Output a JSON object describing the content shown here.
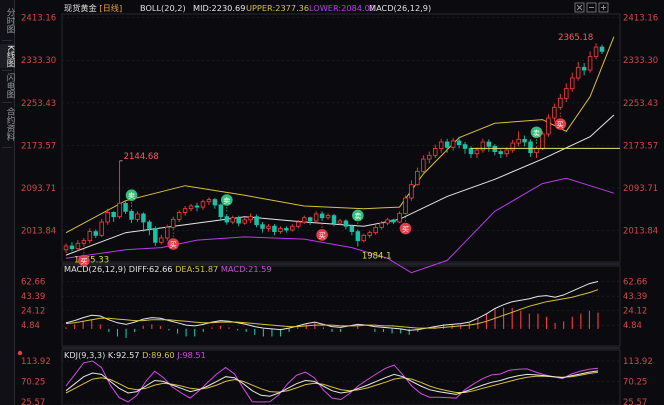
{
  "sidebar": {
    "tabs": [
      {
        "label": "分时图",
        "active": false
      },
      {
        "label": "K线图",
        "active": true
      },
      {
        "label": "闪电图",
        "active": false
      },
      {
        "label": "合约资料",
        "active": false
      }
    ]
  },
  "main_info": {
    "symbol": "现货黄金",
    "period": "[日线]",
    "boll": "BOLL(20,2)",
    "mid": "MID:2230.69",
    "upper": "UPPER:2377.36",
    "lower": "LOWER:2084.02",
    "macd": "MACD(26,12,9)"
  },
  "macd_info": {
    "name": "MACD(26,12,9)",
    "diff": "DIFF:62.66",
    "dea": "DEA:51.87",
    "macd": "MACD:21.59"
  },
  "kdj_info": {
    "name": "KDJ(9,3,3)",
    "k": "K:92.57",
    "d": "D:89.60",
    "j": "J:98.51"
  },
  "colors": {
    "up": "#ff3b3b",
    "down": "#19c2a6",
    "mid": "#e7e7e7",
    "upper": "#d7c03e",
    "lower": "#b93be6",
    "bg": "#0b0b0f",
    "grid": "#2a2a33"
  },
  "chart_data": [
    {
      "type": "candlestick",
      "title": "现货黄金 [日线]",
      "y_ticks": [
        2413.16,
        2333.3,
        2253.43,
        2173.57,
        2093.71,
        2013.84
      ],
      "ylim": [
        1955,
        2420
      ],
      "annotations": [
        {
          "text": "2144.68",
          "kind": "high"
        },
        {
          "text": "1965.33",
          "kind": "low"
        },
        {
          "text": "1984.1",
          "kind": "low"
        },
        {
          "text": "2365.18",
          "kind": "high"
        }
      ],
      "signals": [
        "卖",
        "买"
      ],
      "candles": [
        [
          1978,
          1985,
          1972,
          1990
        ],
        [
          1985,
          1980,
          1975,
          1992
        ],
        [
          1980,
          1990,
          1976,
          1996
        ],
        [
          1990,
          1995,
          1984,
          2000
        ],
        [
          1995,
          2012,
          1990,
          2018
        ],
        [
          2012,
          2005,
          2000,
          2016
        ],
        [
          2005,
          2030,
          2002,
          2036
        ],
        [
          2030,
          2048,
          2025,
          2055
        ],
        [
          2048,
          2040,
          2030,
          2050
        ],
        [
          2040,
          2065,
          2036,
          2144.68
        ],
        [
          2065,
          2050,
          2045,
          2070
        ],
        [
          2050,
          2035,
          2028,
          2054
        ],
        [
          2035,
          2045,
          2030,
          2050
        ],
        [
          2045,
          2030,
          2012,
          2048
        ],
        [
          2030,
          2018,
          2005,
          2034
        ],
        [
          2018,
          1992,
          1985,
          2022
        ],
        [
          1992,
          2000,
          1988,
          2006
        ],
        [
          2000,
          2020,
          1995,
          2025
        ],
        [
          2020,
          2035,
          2015,
          2040
        ],
        [
          2035,
          2048,
          2030,
          2052
        ],
        [
          2048,
          2055,
          2042,
          2060
        ],
        [
          2055,
          2060,
          2050,
          2064
        ],
        [
          2060,
          2058,
          2050,
          2066
        ],
        [
          2058,
          2068,
          2053,
          2072
        ],
        [
          2068,
          2072,
          2062,
          2076
        ],
        [
          2072,
          2062,
          2055,
          2075
        ],
        [
          2062,
          2040,
          2035,
          2065
        ],
        [
          2040,
          2030,
          2025,
          2045
        ],
        [
          2030,
          2038,
          2026,
          2042
        ],
        [
          2038,
          2028,
          2022,
          2042
        ],
        [
          2028,
          2034,
          2025,
          2038
        ],
        [
          2034,
          2040,
          2028,
          2046
        ],
        [
          2040,
          2025,
          2020,
          2044
        ],
        [
          2025,
          2018,
          2010,
          2030
        ],
        [
          2018,
          2022,
          2012,
          2026
        ],
        [
          2022,
          2012,
          2005,
          2026
        ],
        [
          2012,
          2018,
          2008,
          2022
        ],
        [
          2018,
          2015,
          2010,
          2022
        ],
        [
          2015,
          2022,
          2012,
          2026
        ],
        [
          2022,
          2030,
          2018,
          2034
        ],
        [
          2030,
          2038,
          2026,
          2042
        ],
        [
          2038,
          2032,
          2025,
          2040
        ],
        [
          2032,
          2045,
          2028,
          2050
        ],
        [
          2045,
          2038,
          2032,
          2050
        ],
        [
          2038,
          2042,
          2034,
          2046
        ],
        [
          2042,
          2028,
          2022,
          2045
        ],
        [
          2028,
          2032,
          2024,
          2036
        ],
        [
          2032,
          2022,
          2016,
          2035
        ],
        [
          2022,
          2012,
          2005,
          2025
        ],
        [
          2012,
          1995,
          1984.1,
          2016
        ],
        [
          1995,
          2005,
          1992,
          2008
        ],
        [
          2005,
          2010,
          2000,
          2014
        ],
        [
          2010,
          2020,
          2006,
          2024
        ],
        [
          2020,
          2028,
          2016,
          2032
        ],
        [
          2028,
          2034,
          2024,
          2038
        ],
        [
          2034,
          2030,
          2026,
          2036
        ],
        [
          2030,
          2046,
          2028,
          2050
        ],
        [
          2046,
          2075,
          2044,
          2080
        ],
        [
          2075,
          2100,
          2070,
          2108
        ],
        [
          2100,
          2125,
          2098,
          2132
        ],
        [
          2125,
          2148,
          2120,
          2155
        ],
        [
          2148,
          2155,
          2140,
          2162
        ],
        [
          2155,
          2168,
          2150,
          2175
        ],
        [
          2168,
          2180,
          2160,
          2186
        ],
        [
          2180,
          2170,
          2160,
          2186
        ],
        [
          2170,
          2182,
          2164,
          2188
        ],
        [
          2182,
          2175,
          2168,
          2190
        ],
        [
          2175,
          2168,
          2158,
          2180
        ],
        [
          2168,
          2158,
          2150,
          2172
        ],
        [
          2158,
          2165,
          2150,
          2170
        ],
        [
          2165,
          2180,
          2160,
          2186
        ],
        [
          2180,
          2172,
          2162,
          2185
        ],
        [
          2172,
          2162,
          2155,
          2176
        ],
        [
          2162,
          2158,
          2150,
          2166
        ],
        [
          2158,
          2165,
          2152,
          2170
        ],
        [
          2165,
          2178,
          2160,
          2184
        ],
        [
          2178,
          2185,
          2172,
          2200
        ],
        [
          2185,
          2180,
          2172,
          2192
        ],
        [
          2180,
          2160,
          2152,
          2185
        ],
        [
          2160,
          2168,
          2150,
          2172
        ],
        [
          2168,
          2195,
          2165,
          2200
        ],
        [
          2195,
          2225,
          2190,
          2232
        ],
        [
          2225,
          2245,
          2218,
          2252
        ],
        [
          2245,
          2262,
          2240,
          2270
        ],
        [
          2262,
          2280,
          2255,
          2290
        ],
        [
          2280,
          2300,
          2274,
          2310
        ],
        [
          2300,
          2320,
          2295,
          2330
        ],
        [
          2320,
          2315,
          2305,
          2328
        ],
        [
          2315,
          2340,
          2310,
          2350
        ],
        [
          2340,
          2358,
          2335,
          2365.18
        ],
        [
          2358,
          2350,
          2345,
          2362
        ]
      ],
      "boll": {
        "mid": [
          [
            0,
            1968
          ],
          [
            10,
            2010
          ],
          [
            20,
            2025
          ],
          [
            30,
            2040
          ],
          [
            40,
            2030
          ],
          [
            50,
            2022
          ],
          [
            56,
            2035
          ],
          [
            64,
            2078
          ],
          [
            72,
            2110
          ],
          [
            80,
            2148
          ],
          [
            88,
            2190
          ],
          [
            92,
            2230.69
          ]
        ],
        "upper": [
          [
            0,
            2010
          ],
          [
            10,
            2070
          ],
          [
            20,
            2098
          ],
          [
            30,
            2080
          ],
          [
            40,
            2060
          ],
          [
            50,
            2055
          ],
          [
            56,
            2058
          ],
          [
            60,
            2120
          ],
          [
            66,
            2188
          ],
          [
            72,
            2215
          ],
          [
            80,
            2222
          ],
          [
            84,
            2200
          ],
          [
            88,
            2265
          ],
          [
            92,
            2377.36
          ]
        ],
        "lower": [
          [
            0,
            1962
          ],
          [
            10,
            1978
          ],
          [
            16,
            1982
          ],
          [
            22,
            1996
          ],
          [
            30,
            2002
          ],
          [
            40,
            1998
          ],
          [
            48,
            1982
          ],
          [
            54,
            1962
          ],
          [
            58,
            1935
          ],
          [
            64,
            1958
          ],
          [
            72,
            2050
          ],
          [
            80,
            2102
          ],
          [
            84,
            2112
          ],
          [
            88,
            2098
          ],
          [
            92,
            2084.02
          ]
        ]
      },
      "markers": [
        {
          "i": 3,
          "type": "买",
          "side": "below"
        },
        {
          "i": 11,
          "type": "卖",
          "side": "above"
        },
        {
          "i": 18,
          "type": "买",
          "side": "below"
        },
        {
          "i": 27,
          "type": "卖",
          "side": "above"
        },
        {
          "i": 43,
          "type": "买",
          "side": "below"
        },
        {
          "i": 49,
          "type": "卖",
          "side": "above"
        },
        {
          "i": 57,
          "type": "买",
          "side": "below"
        },
        {
          "i": 79,
          "type": "卖",
          "side": "above"
        },
        {
          "i": 83,
          "type": "买",
          "side": "below"
        }
      ],
      "hline": 2168
    },
    {
      "type": "macd",
      "title": "MACD(26,12,9)",
      "y_ticks": [
        62.66,
        43.39,
        24.12,
        4.84
      ],
      "ylim": [
        -20,
        70
      ],
      "diff": [
        8,
        11,
        15,
        18,
        17,
        12,
        8,
        6,
        9,
        13,
        15,
        14,
        11,
        8,
        5,
        4,
        6,
        9,
        11,
        10,
        8,
        6,
        3,
        1,
        0,
        -1,
        1,
        4,
        7,
        9,
        6,
        3,
        2,
        4,
        6,
        5,
        3,
        2,
        1,
        0,
        -2,
        -1,
        1,
        3,
        5,
        6,
        7,
        9,
        14,
        20,
        27,
        32,
        36,
        38,
        40,
        43,
        44,
        42,
        45,
        50,
        55,
        60,
        62.66
      ],
      "dea": [
        7,
        8,
        10,
        12,
        14,
        14,
        13,
        12,
        11,
        11,
        12,
        12,
        12,
        11,
        10,
        9,
        8,
        8,
        9,
        9,
        9,
        8,
        7,
        6,
        5,
        4,
        3,
        3,
        4,
        5,
        5,
        5,
        4,
        4,
        4,
        5,
        5,
        4,
        4,
        3,
        2,
        1,
        1,
        1,
        2,
        3,
        4,
        5,
        7,
        10,
        14,
        18,
        22,
        26,
        30,
        33,
        36,
        38,
        40,
        42,
        45,
        48,
        51.87
      ]
    },
    {
      "type": "kdj",
      "title": "KDJ(9,3,3)",
      "y_ticks": [
        113.92,
        70.25,
        25.57
      ],
      "ylim": [
        25.57,
        125
      ],
      "k": [
        50,
        65,
        80,
        88,
        85,
        70,
        55,
        45,
        48,
        60,
        72,
        70,
        62,
        55,
        48,
        52,
        60,
        70,
        80,
        78,
        65,
        50,
        40,
        38,
        45,
        55,
        65,
        72,
        70,
        60,
        50,
        45,
        48,
        55,
        62,
        70,
        78,
        85,
        80,
        70,
        60,
        52,
        48,
        45,
        42,
        48,
        55,
        62,
        68,
        72,
        78,
        82,
        85,
        84,
        82,
        80,
        78,
        82,
        86,
        90,
        92.57
      ],
      "d": [
        45,
        55,
        65,
        75,
        78,
        74,
        65,
        55,
        52,
        55,
        62,
        66,
        64,
        60,
        55,
        53,
        56,
        62,
        70,
        74,
        70,
        62,
        54,
        48,
        47,
        50,
        56,
        63,
        66,
        64,
        58,
        52,
        50,
        52,
        56,
        62,
        68,
        75,
        78,
        75,
        68,
        60,
        54,
        50,
        46,
        46,
        50,
        55,
        60,
        65,
        70,
        75,
        79,
        81,
        81,
        80,
        79,
        80,
        83,
        87,
        89.6
      ],
      "j": [
        60,
        85,
        110,
        113.92,
        100,
        62,
        35,
        25.57,
        40,
        70,
        92,
        78,
        58,
        45,
        34,
        50,
        68,
        86,
        100,
        86,
        55,
        26,
        25.57,
        26,
        41,
        65,
        83,
        90,
        78,
        52,
        34,
        31,
        44,
        61,
        74,
        86,
        98,
        105,
        84,
        60,
        44,
        36,
        36,
        35,
        34,
        52,
        65,
        76,
        84,
        86,
        94,
        96,
        97,
        90,
        84,
        80,
        76,
        86,
        92,
        96,
        98.51
      ]
    }
  ]
}
